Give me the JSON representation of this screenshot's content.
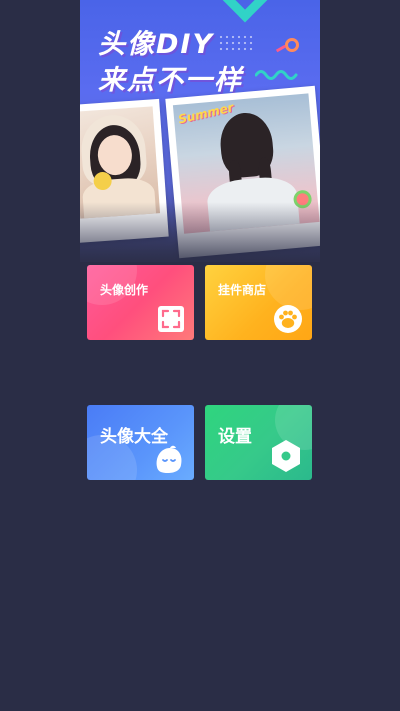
{
  "banner": {
    "title_line1": "头像DIY",
    "title_line2": "来点不一样",
    "sticker_text": "Summer",
    "colors": {
      "bg_top": "#4a64e8",
      "accent_teal": "#31d3c7"
    }
  },
  "tiles": [
    {
      "label": "头像创作",
      "icon": "scan-frame-icon",
      "color": "#ff4f7d"
    },
    {
      "label": "挂件商店",
      "icon": "paw-icon",
      "color": "#ffb21e"
    },
    {
      "label": "头像大全",
      "icon": "cute-face-icon",
      "color": "#5a95fb"
    },
    {
      "label": "设置",
      "icon": "hexagon-settings-icon",
      "color": "#36c98a"
    }
  ],
  "page": {
    "background": "#2a2d46"
  }
}
